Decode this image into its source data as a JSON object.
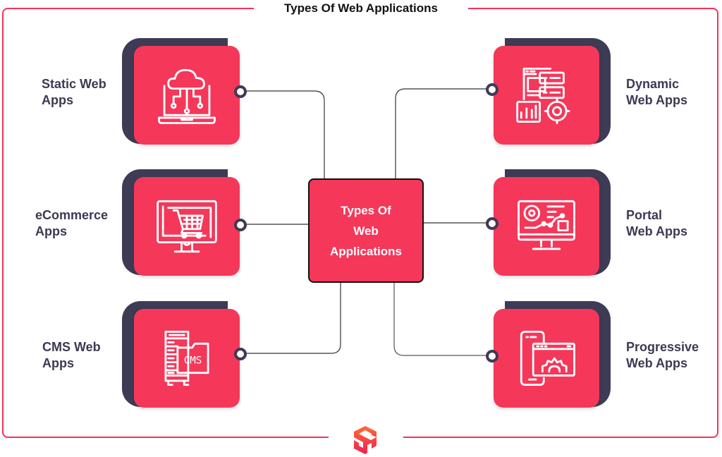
{
  "title": "Types Of Web Applications",
  "center": {
    "lines": [
      "Types Of",
      "Web",
      "Applications"
    ]
  },
  "colors": {
    "accent": "#f5375a",
    "dark": "#3e3b55",
    "frame": "#f5325a",
    "text": "#3b3a52"
  },
  "left_items": [
    {
      "label_line1": "Static Web",
      "label_line2": "Apps",
      "icon": "cloud-laptop-icon"
    },
    {
      "label_line1": "eCommerce",
      "label_line2": "Apps",
      "icon": "shopping-cart-monitor-icon"
    },
    {
      "label_line1": "CMS Web",
      "label_line2": "Apps",
      "icon": "cms-server-icon",
      "icon_text": "CMS"
    }
  ],
  "right_items": [
    {
      "label_line1": "Dynamic",
      "label_line2": "Web Apps",
      "icon": "dashboard-gear-icon"
    },
    {
      "label_line1": "Portal",
      "label_line2": "Web Apps",
      "icon": "analytics-monitor-icon"
    },
    {
      "label_line1": "Progressive",
      "label_line2": "Web Apps",
      "icon": "mobile-browser-gear-icon"
    }
  ],
  "footer_logo": "cube-logo-icon"
}
